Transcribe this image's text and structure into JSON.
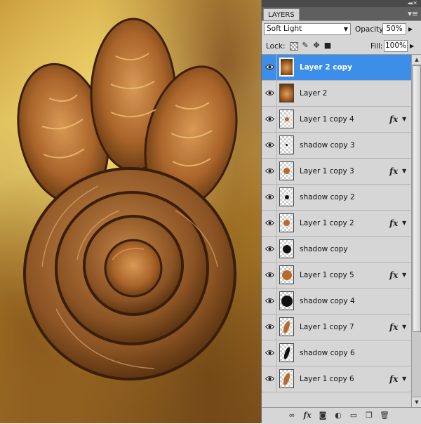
{
  "panel": {
    "tab_label": "LAYERS",
    "blend_mode": "Soft Light",
    "opacity_label": "Opacity:",
    "opacity_value": "50%",
    "lock_label": "Lock:",
    "fill_label": "Fill:",
    "fill_value": "100%"
  },
  "layers": [
    {
      "name": "Layer 2 copy",
      "selected": true,
      "fx": false,
      "thumb": "art"
    },
    {
      "name": "Layer 2",
      "selected": false,
      "fx": false,
      "thumb": "art"
    },
    {
      "name": "Layer 1 copy 4",
      "selected": false,
      "fx": true,
      "thumb": "small-brown"
    },
    {
      "name": "shadow copy 3",
      "selected": false,
      "fx": false,
      "thumb": "tiny-black"
    },
    {
      "name": "Layer 1 copy 3",
      "selected": false,
      "fx": true,
      "thumb": "brown"
    },
    {
      "name": "shadow copy 2",
      "selected": false,
      "fx": false,
      "thumb": "small-black"
    },
    {
      "name": "Layer 1 copy 2",
      "selected": false,
      "fx": true,
      "thumb": "brown"
    },
    {
      "name": "shadow copy",
      "selected": false,
      "fx": false,
      "thumb": "black"
    },
    {
      "name": "Layer 1 copy 5",
      "selected": false,
      "fx": true,
      "thumb": "big-brown"
    },
    {
      "name": "shadow copy 4",
      "selected": false,
      "fx": false,
      "thumb": "big-black"
    },
    {
      "name": "Layer 1 copy 7",
      "selected": false,
      "fx": true,
      "thumb": "petal-brown"
    },
    {
      "name": "shadow copy 6",
      "selected": false,
      "fx": false,
      "thumb": "petal-black"
    },
    {
      "name": "Layer 1 copy 6",
      "selected": false,
      "fx": true,
      "thumb": "petal-brown"
    }
  ],
  "fx_symbol": "fx",
  "icons": {
    "eye": "eye-icon",
    "link": "link-icon",
    "fx_add": "fx-icon",
    "mask": "mask-icon",
    "adjust": "adjustment-icon",
    "group": "folder-icon",
    "new_layer": "new-layer-icon",
    "trash": "trash-icon"
  }
}
